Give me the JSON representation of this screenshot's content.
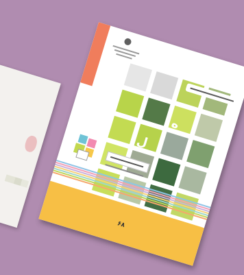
{
  "book": {
    "page_number": "۶۸"
  },
  "colors": {
    "background": "#b08cb0",
    "spine": "#f07d5c",
    "footer": "#f7bf45",
    "tile_light": "#c8dc3f",
    "tile_dark": "#3f6b40",
    "tile_mid": "#8da070",
    "tile_grey": "#a7a7a4"
  },
  "tiles": [
    {
      "color": "#e6e6e6"
    },
    {
      "color": "#d9d9d9"
    },
    {
      "color": "#bcd35a"
    },
    {
      "color": "#a2b87b"
    },
    {
      "color": "#b8d44a"
    },
    {
      "color": "#547a48"
    },
    {
      "color": "#cde05f"
    },
    {
      "color": "#bfc9a9"
    },
    {
      "color": "#c3db52"
    },
    {
      "color": "#b6d24b"
    },
    {
      "color": "#9aa99c"
    },
    {
      "color": "#7fa06f"
    },
    {
      "color": "#d0e464"
    },
    {
      "color": "#9faa94"
    },
    {
      "color": "#3d6a3f"
    },
    {
      "color": "#a9b8a0"
    },
    {
      "color": "#c8de5a"
    },
    {
      "color": "#b8c8a6"
    },
    {
      "color": "#426e44"
    },
    {
      "color": "#c2d866"
    }
  ],
  "stripe_colors": [
    "#8ec3e6",
    "#f2a0b7",
    "#c9b1dd",
    "#f6d17a",
    "#9fd7c8",
    "#bfd65a",
    "#f5a86c"
  ]
}
